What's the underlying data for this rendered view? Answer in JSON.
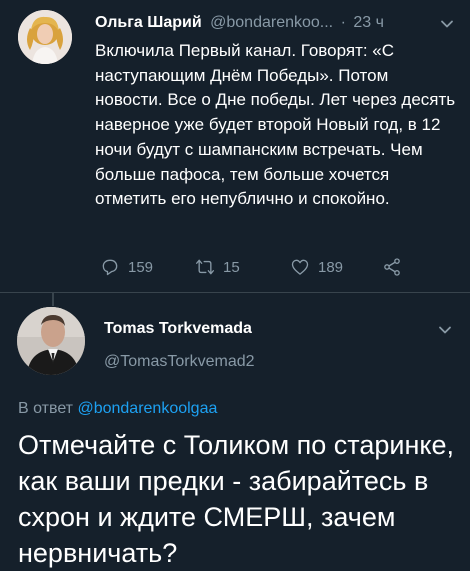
{
  "tweet1": {
    "author_name": "Ольга Шарий",
    "author_handle": "@bondarenkoo...",
    "separator": "·",
    "time": "23 ч",
    "text": "Включила Первый канал. Говорят: «С наступающим Днём Победы». Потом новости. Все о Дне победы. Лет через десять наверное уже будет второй Новый год, в 12 ночи будут с шампанским встречать. Чем больше пафоса, тем больше хочется отметить его непублично и спокойно.",
    "replies": "159",
    "retweets": "15",
    "likes": "189"
  },
  "tweet2": {
    "author_name": "Tomas Torkvemada",
    "author_handle": "@TomasTorkvemad2",
    "reply_prefix": "В ответ",
    "reply_handle": "@bondarenkoolgaa",
    "text": "Отмечайте с Толиком по старинке, как ваши предки - забирайтесь в схрон и ждите СМЕРШ, зачем нервничать?"
  },
  "icons": {
    "reply": "reply-icon",
    "retweet": "retweet-icon",
    "like": "heart-icon",
    "share": "share-icon",
    "menu": "chevron-down-icon"
  },
  "colors": {
    "background": "#15202b",
    "text": "#ffffff",
    "secondary": "#8899a6",
    "link": "#1da1f2",
    "divider": "#38444d"
  }
}
